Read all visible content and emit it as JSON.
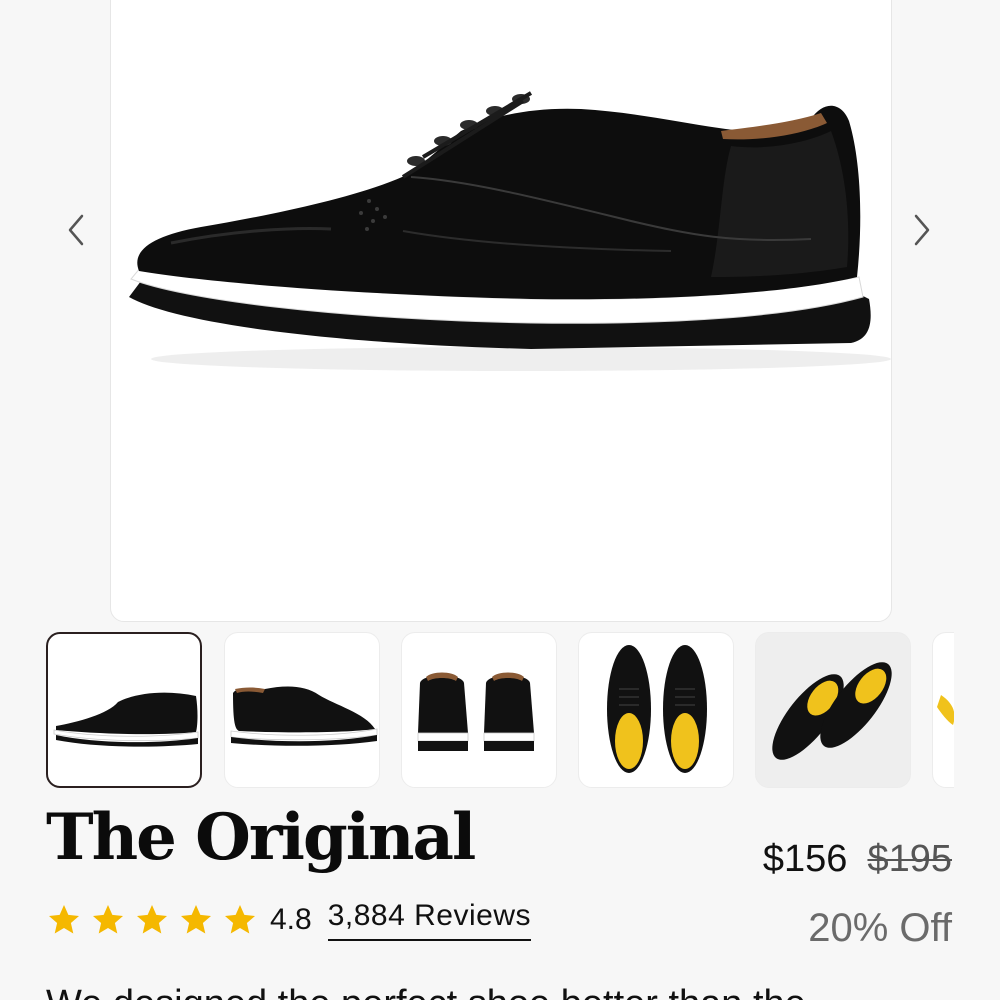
{
  "product": {
    "title": "The Original",
    "price_current": "$156",
    "price_original": "$195",
    "discount": "20% Off",
    "rating_value": "4.8",
    "rating_stars": 5,
    "reviews_label": "3,884 Reviews",
    "description_partial": "We designed the perfect shoe better than the"
  },
  "gallery": {
    "prev_icon": "chevron-left-icon",
    "next_icon": "chevron-right-icon",
    "thumbnails": [
      {
        "name": "thumbnail-side-view",
        "active": true
      },
      {
        "name": "thumbnail-side-view-alt",
        "active": false
      },
      {
        "name": "thumbnail-back-view",
        "active": false
      },
      {
        "name": "thumbnail-top-view",
        "active": false
      },
      {
        "name": "thumbnail-pair-angled",
        "active": false
      },
      {
        "name": "thumbnail-partial",
        "active": false
      }
    ]
  },
  "colors": {
    "star": "#f5b800",
    "shoe_upper": "#0d0d0d",
    "shoe_sole": "#ffffff",
    "insole": "#f0c21c",
    "active_border": "#2a1f1f"
  }
}
